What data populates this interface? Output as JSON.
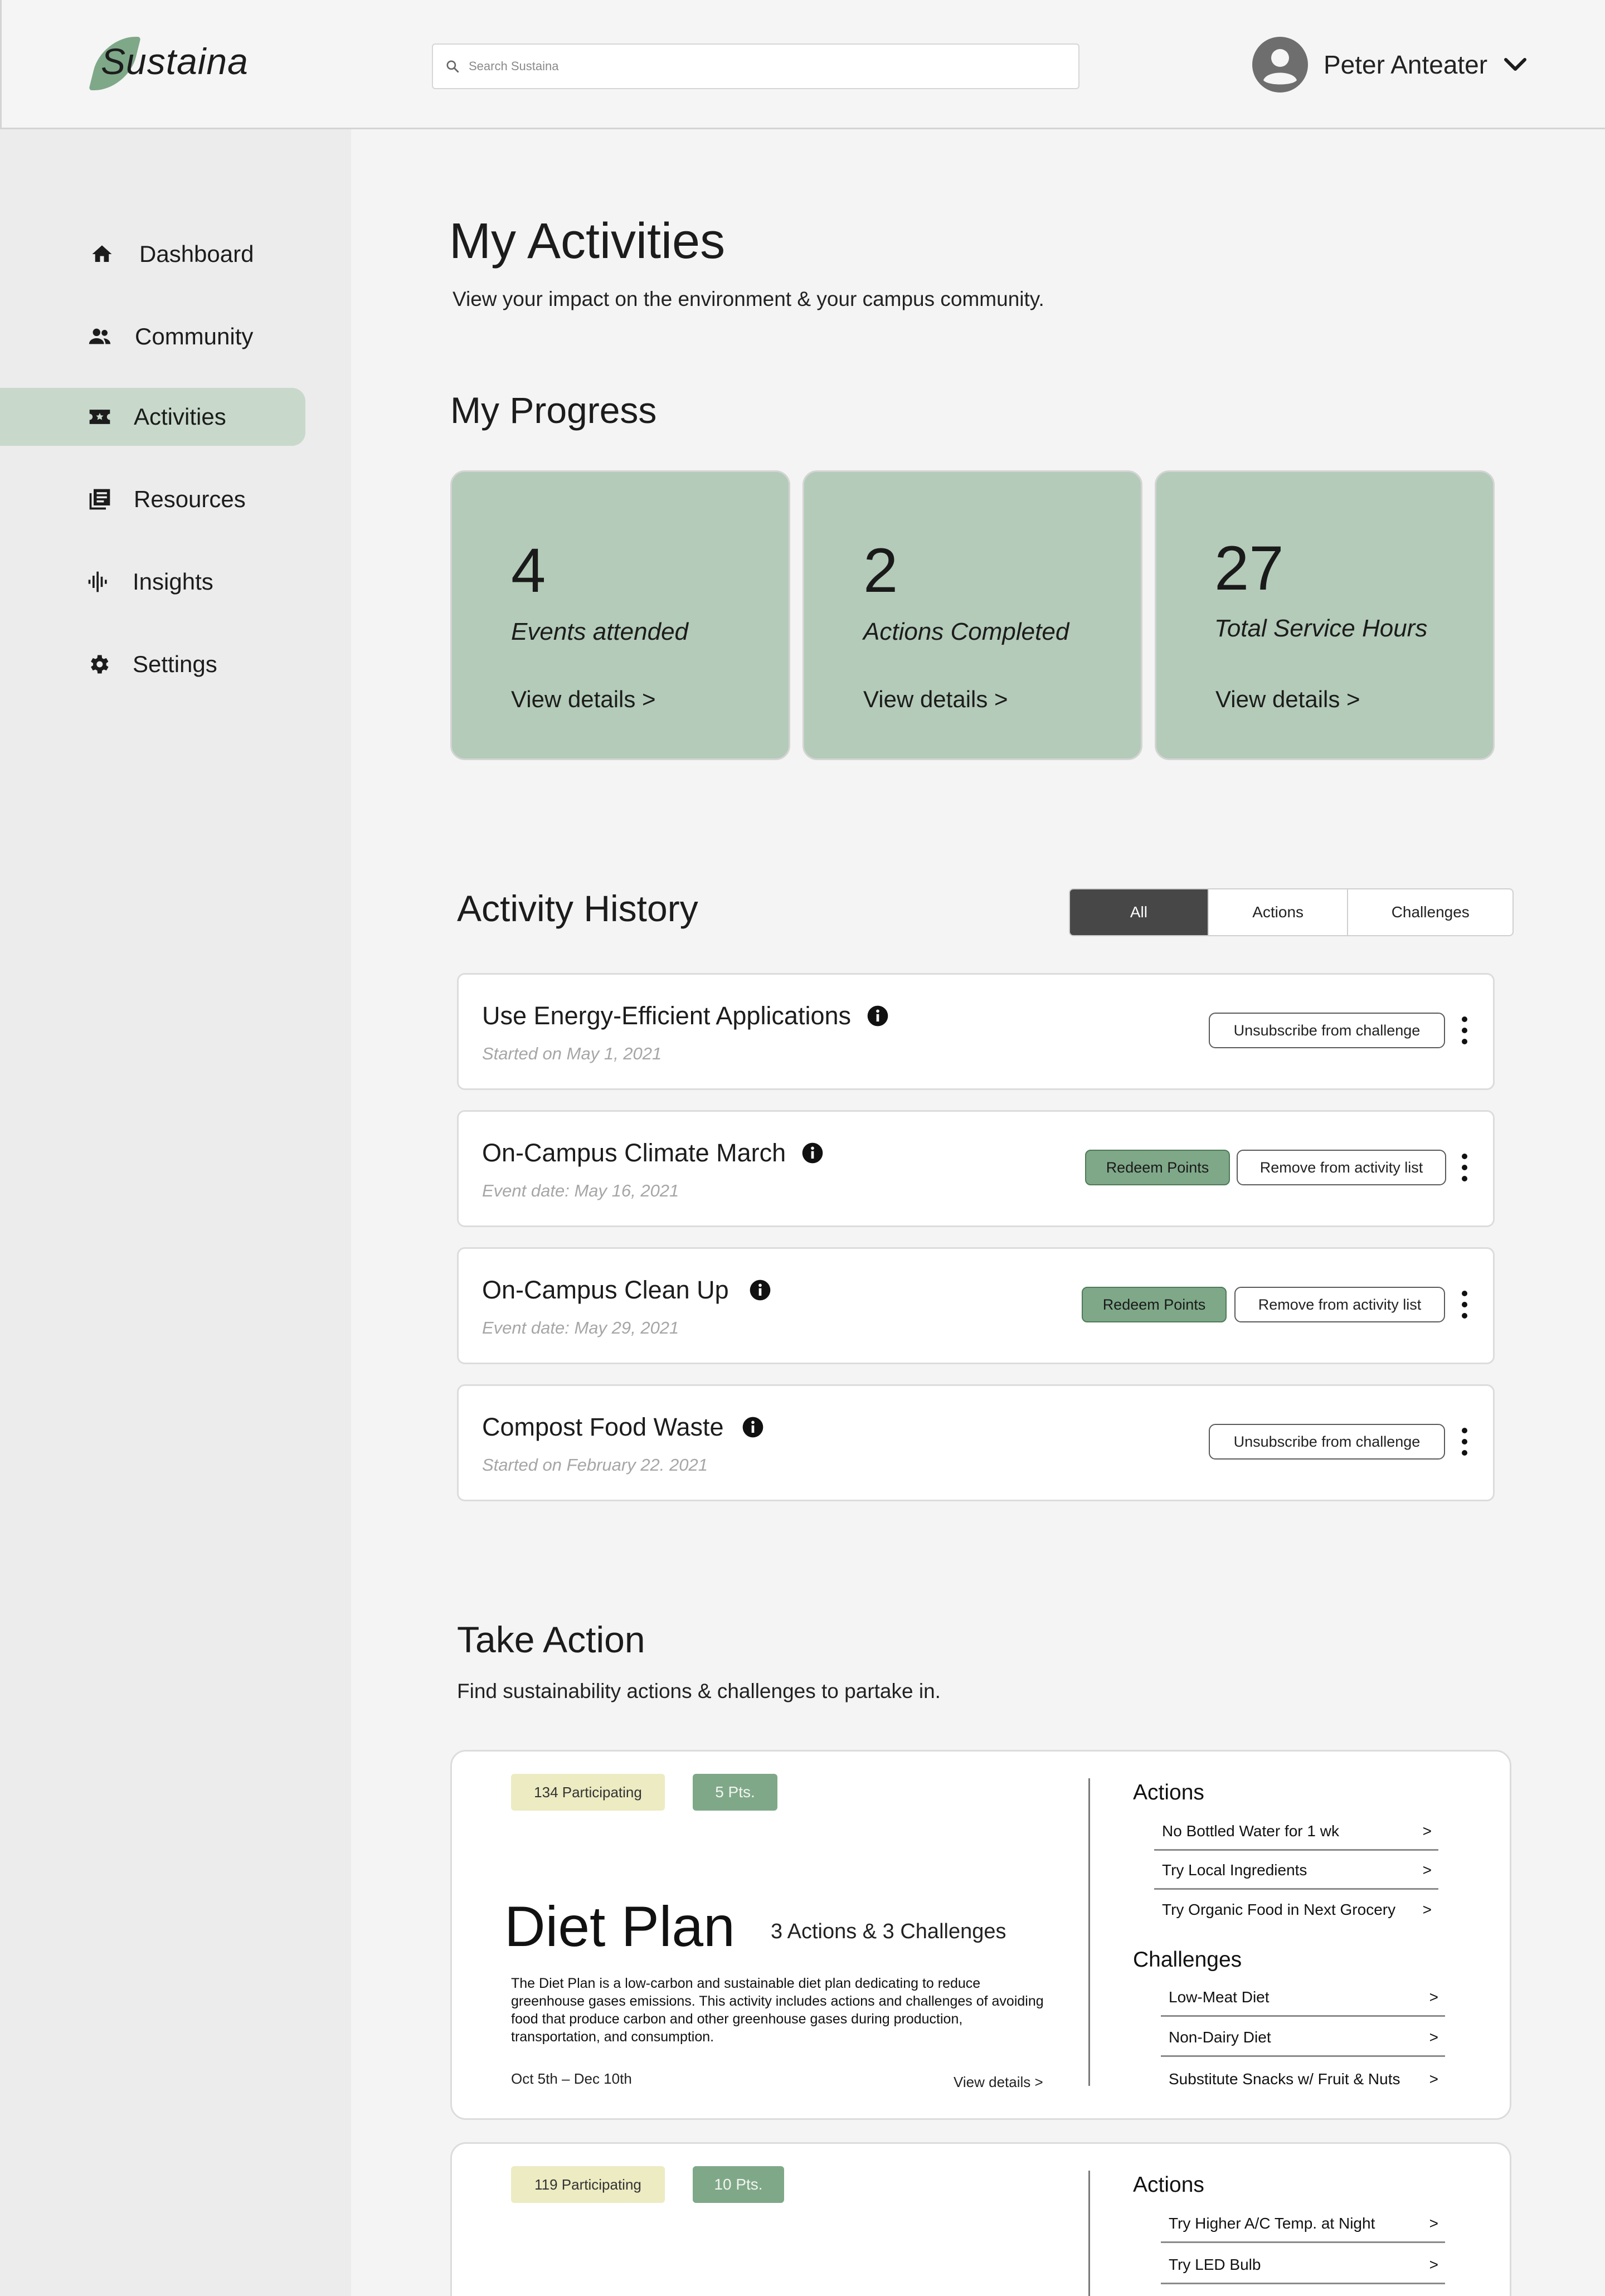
{
  "header": {
    "logo_text": "Sustaina",
    "search_placeholder": "Search Sustaina",
    "user_name": "Peter Anteater"
  },
  "sidebar": {
    "items": [
      {
        "label": "Dashboard",
        "icon": "home-icon"
      },
      {
        "label": "Community",
        "icon": "people-icon"
      },
      {
        "label": "Activities",
        "icon": "ticket-icon",
        "active": true
      },
      {
        "label": "Resources",
        "icon": "library-icon"
      },
      {
        "label": "Insights",
        "icon": "waveform-icon"
      },
      {
        "label": "Settings",
        "icon": "gear-icon"
      }
    ]
  },
  "page": {
    "title": "My Activities",
    "subtitle": "View your impact on the environment & your campus community."
  },
  "progress": {
    "title": "My Progress",
    "cards": [
      {
        "value": "4",
        "label": "Events attended",
        "link": "View details >"
      },
      {
        "value": "2",
        "label": "Actions Completed",
        "link": "View details >"
      },
      {
        "value": "27",
        "label": "Total Service Hours",
        "link": "View details >"
      }
    ]
  },
  "history": {
    "title": "Activity History",
    "tabs": [
      "All",
      "Actions",
      "Challenges"
    ],
    "active_tab": "All",
    "items": [
      {
        "title": "Use Energy-Efficient Applications",
        "sub": "Started on May 1, 2021",
        "primary": "",
        "secondary": "Unsubscribe from challenge"
      },
      {
        "title": "On-Campus Climate March",
        "sub": "Event date: May 16, 2021",
        "primary": "Redeem Points",
        "secondary": "Remove from activity list"
      },
      {
        "title": "On-Campus Clean Up",
        "sub": "Event date: May 29, 2021",
        "primary": "Redeem Points",
        "secondary": "Remove from activity list"
      },
      {
        "title": "Compost Food Waste",
        "sub": "Started on February 22. 2021",
        "primary": "",
        "secondary": "Unsubscribe from challenge"
      }
    ]
  },
  "take_action": {
    "title": "Take Action",
    "subtitle": "Find sustainability actions & challenges to partake in.",
    "cards": [
      {
        "participating": "134 Participating",
        "points": "5 Pts.",
        "title": "Diet Plan",
        "count": "3 Actions & 3 Challenges",
        "description": "The Diet Plan is a low-carbon and sustainable diet plan dedicating to reduce greenhouse gases emissions. This activity includes actions and challenges of avoiding food that produce carbon and other greenhouse gases during production, transportation, and consumption.",
        "dates": "Oct 5th – Dec 10th",
        "link": "View details >",
        "actions_title": "Actions",
        "actions": [
          "No Bottled Water for 1 wk",
          "Try Local Ingredients",
          "Try Organic Food in Next Grocery"
        ],
        "challenges_title": "Challenges",
        "challenges": [
          "Low-Meat Diet",
          "Non-Dairy Diet",
          "Substitute Snacks w/ Fruit & Nuts"
        ]
      },
      {
        "participating": "119 Participating",
        "points": "10 Pts.",
        "actions_title": "Actions",
        "actions": [
          "Try Higher A/C Temp. at Night",
          "Try LED Bulb"
        ]
      }
    ],
    "arrow": ">"
  },
  "colors": {
    "accent_green": "#7fa889",
    "card_green": "#b3cbb8",
    "sidebar_active": "#c8d9cb",
    "pill_yellow": "#ecebc2",
    "tab_active": "#474747"
  }
}
